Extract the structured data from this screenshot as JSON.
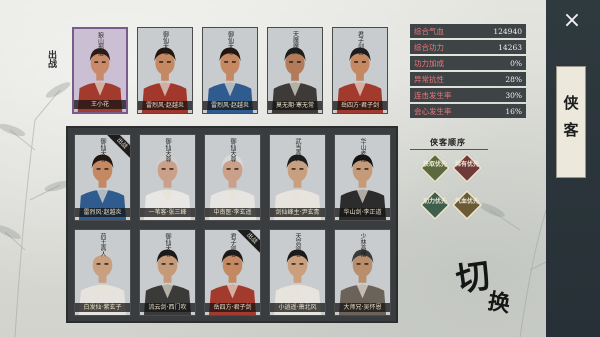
{
  "side_label": "出战",
  "close_icon": "×",
  "tab_label": "侠客",
  "switch_label": {
    "main": "切",
    "sub": "换"
  },
  "stats": [
    {
      "name": "综合气血",
      "value": "124940"
    },
    {
      "name": "综合功力",
      "value": "14263"
    },
    {
      "name": "功力加成",
      "value": "0%"
    },
    {
      "name": "异常抗性",
      "value": "28%"
    },
    {
      "name": "连击发生率",
      "value": "30%"
    },
    {
      "name": "会心发生率",
      "value": "16%"
    }
  ],
  "team": [
    {
      "sect": "狼山部落",
      "name": "王小花",
      "selected": true,
      "skin": "#c98a6a",
      "robe": "#a33a2e",
      "hair": "#2a1c14"
    },
    {
      "sect": "御仙天尊",
      "name": "雷烈风·赵越炎",
      "selected": false,
      "skin": "#c48863",
      "robe": "#a2372c",
      "hair": "#22160f"
    },
    {
      "sect": "御仙天尊",
      "name": "雷烈风·赵越炎",
      "selected": false,
      "skin": "#c48863",
      "robe": "#2f5b8e",
      "hair": "#22160f"
    },
    {
      "sect": "天魔魔人",
      "name": "莫无期·寒无常",
      "selected": false,
      "skin": "#b27c5a",
      "robe": "#3d3a37",
      "hair": "#1d1d1d"
    },
    {
      "sect": "君子剑客",
      "name": "岳四方·君子剑",
      "selected": false,
      "skin": "#c48863",
      "robe": "#a33a2e",
      "hair": "#1d1d1d"
    }
  ],
  "roster": [
    {
      "sect": "御仙天尊",
      "name": "雷烈风·赵越炎",
      "tag": "出战",
      "robe": "#2f5b8e",
      "hair": "#22160f",
      "skin": "#c48863"
    },
    {
      "sect": "御仙天尊",
      "name": "一苇客·张三峰",
      "tag": "",
      "robe": "#e9e7e3",
      "hair": "#cfcfcf",
      "skin": "#caa088"
    },
    {
      "sect": "御仙天尊",
      "name": "中南医·李玄遥",
      "tag": "",
      "robe": "#e6e5e1",
      "hair": "#d9d9d9",
      "skin": "#caa088"
    },
    {
      "sect": "武当真人",
      "name": "剑仙峰主·尹玄青",
      "tag": "",
      "robe": "#e7e3dd",
      "hair": "#1c1c1c",
      "skin": "#c9a07f"
    },
    {
      "sect": "华山老怪",
      "name": "华山剑·李正道",
      "tag": "",
      "robe": "#2c2c2c",
      "hair": "#131313",
      "skin": "#c49a78"
    },
    {
      "sect": "药王真人",
      "name": "白发仙·紫玄子",
      "tag": "",
      "robe": "#e6e3de",
      "hair": "#cccccc",
      "skin": "#c9a07f"
    },
    {
      "sect": "御仙天尊",
      "name": "流云剑·西门吹",
      "tag": "",
      "robe": "#3a3a38",
      "hair": "#1a1a1a",
      "skin": "#c49a78"
    },
    {
      "sect": "君子剑客",
      "name": "岳四方·君子剑",
      "tag": "出战",
      "robe": "#a33a2e",
      "hair": "#1a1a1a",
      "skin": "#c48863"
    },
    {
      "sect": "天宫剑客",
      "name": "小逍遥·萧北风",
      "tag": "",
      "robe": "#e7e4de",
      "hair": "#1a1a1a",
      "skin": "#c99f7e"
    },
    {
      "sect": "少林高僧",
      "name": "大师兄·吴怀恩",
      "tag": "",
      "robe": "#6b6259",
      "hair": "#3a3a3a",
      "skin": "#b98e6d"
    }
  ],
  "order": {
    "title": "侠客顺序",
    "slots": [
      {
        "label": "获取优先",
        "color": "#5b6a3e"
      },
      {
        "label": "稀有优先",
        "color": "#6f3a3a"
      },
      {
        "label": "功力优先",
        "color": "#3e5f4c"
      },
      {
        "label": "气血优先",
        "color": "#6a5a36"
      }
    ]
  }
}
